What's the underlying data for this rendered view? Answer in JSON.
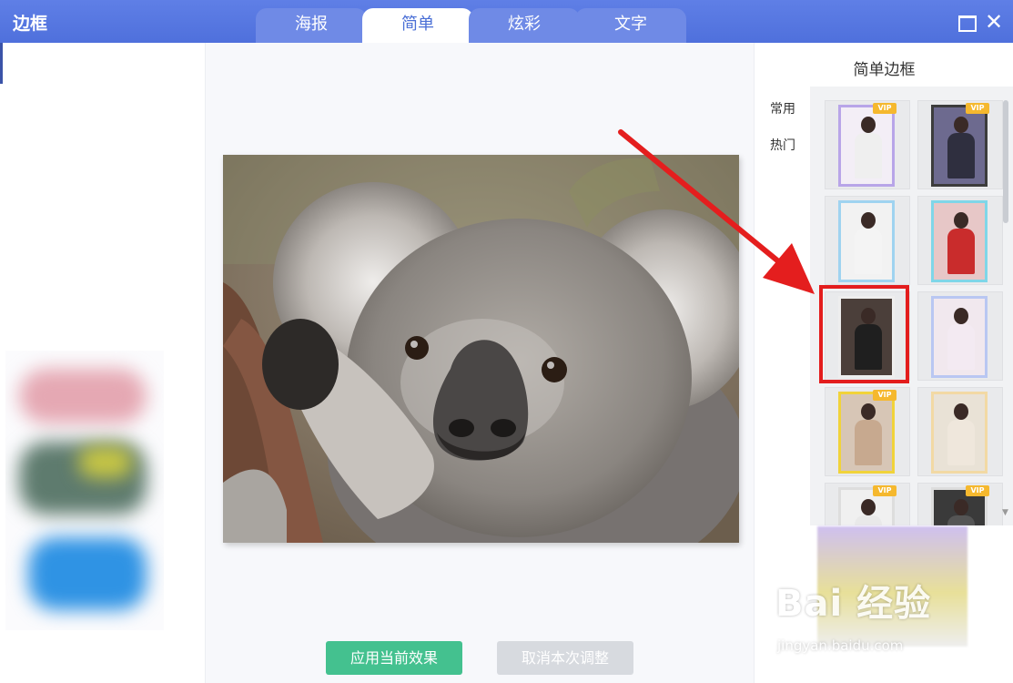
{
  "window": {
    "title": "边框",
    "tabs": [
      {
        "label": "海报",
        "active": false
      },
      {
        "label": "简单",
        "active": true
      },
      {
        "label": "炫彩",
        "active": false
      },
      {
        "label": "文字",
        "active": false
      }
    ],
    "close_glyph": "✕"
  },
  "actions": {
    "apply_label": "应用当前效果",
    "cancel_label": "取消本次调整"
  },
  "frames_panel": {
    "title": "简单边框",
    "categories": [
      "常用",
      "热门"
    ],
    "vip_badge": "VIP",
    "thumbnails": [
      {
        "vip": true,
        "frame_color": "#b8a5e8",
        "selected": false
      },
      {
        "vip": true,
        "frame_color": "#3c3c3c",
        "selected": false
      },
      {
        "vip": false,
        "frame_color": "#9fd3f0",
        "selected": false
      },
      {
        "vip": false,
        "frame_color": "#7fd6e8",
        "selected": false
      },
      {
        "vip": false,
        "frame_color": "#eeeeee",
        "selected": true
      },
      {
        "vip": false,
        "frame_color": "#b9c7f2",
        "selected": false
      },
      {
        "vip": true,
        "frame_color": "#f1d33a",
        "selected": false
      },
      {
        "vip": false,
        "frame_color": "#f2d9a4",
        "selected": false
      },
      {
        "vip": true,
        "frame_color": "#dddddd",
        "selected": false
      },
      {
        "vip": true,
        "frame_color": "#dddddd",
        "selected": false
      }
    ]
  },
  "watermark": {
    "main": "Bai 经验",
    "sub": "jingyan.baidu.com"
  },
  "colors": {
    "titlebar": "#5676e0",
    "apply_button": "#44c18f",
    "cancel_button": "#d7dadf",
    "highlight": "#e31d1d"
  }
}
